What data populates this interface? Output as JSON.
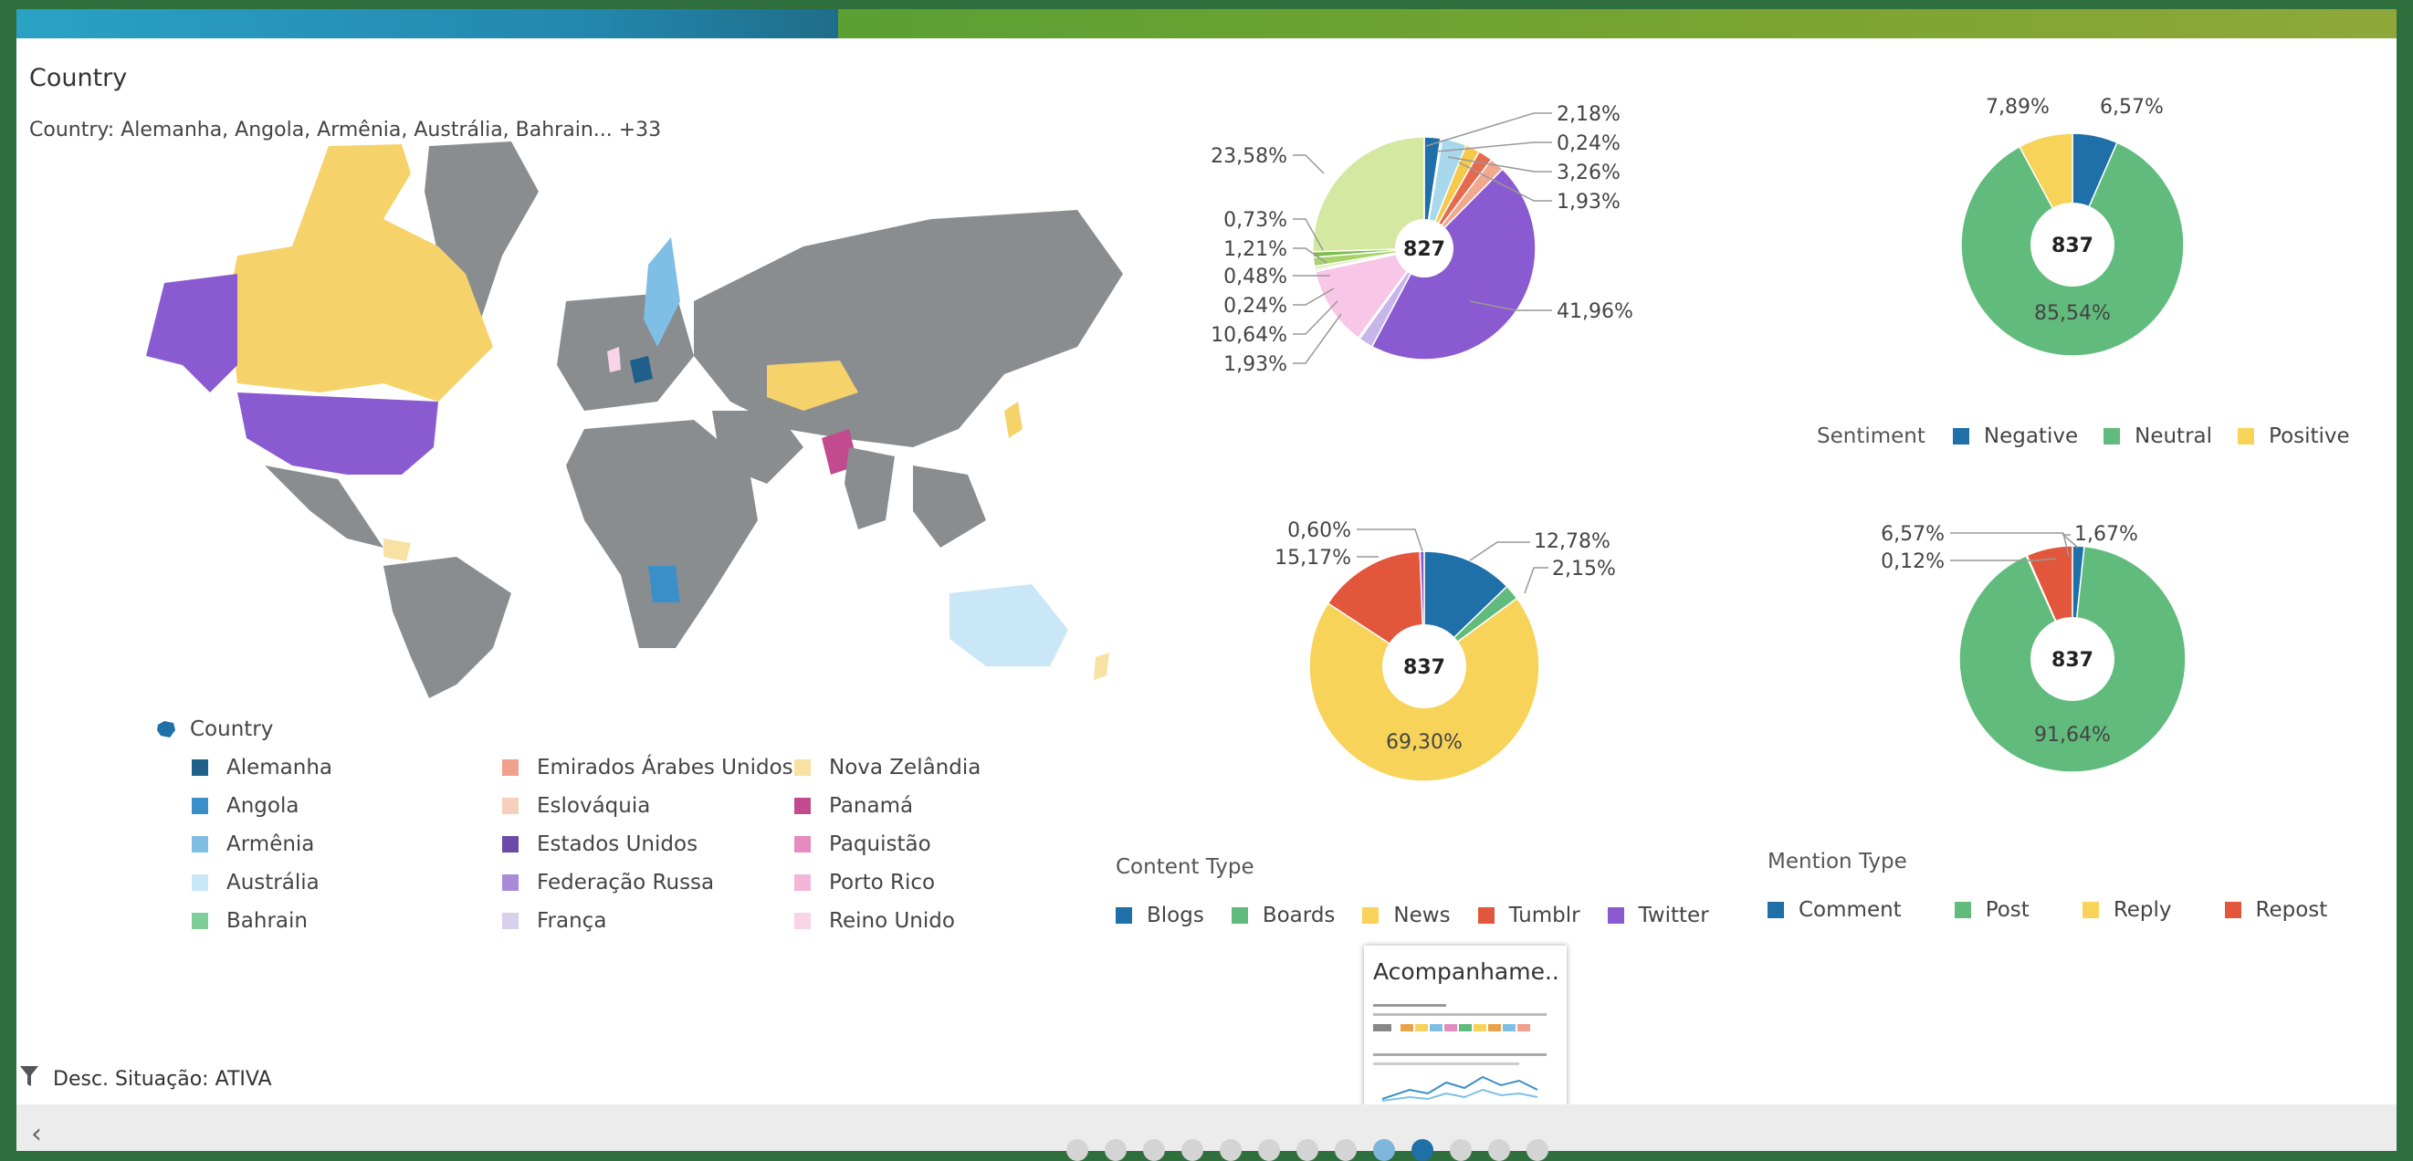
{
  "header": {
    "title": "Country",
    "filter_summary": "Country: Alemanha, Angola, Armênia, Austrália, Bahrain... +33"
  },
  "country_legend": {
    "title": "Country",
    "columns": [
      [
        {
          "label": "Alemanha",
          "color": "#1f5f8b"
        },
        {
          "label": "Angola",
          "color": "#3b8fc8"
        },
        {
          "label": "Armênia",
          "color": "#7fbfe6"
        },
        {
          "label": "Austrália",
          "color": "#c9e7f7"
        },
        {
          "label": "Bahrain",
          "color": "#7fce99"
        }
      ],
      [
        {
          "label": "Emirados Árabes Unidos",
          "color": "#f0a08e"
        },
        {
          "label": "Eslováquia",
          "color": "#f6cfbe"
        },
        {
          "label": "Estados Unidos",
          "color": "#6c4ba8"
        },
        {
          "label": "Federação Russa",
          "color": "#a98ad8"
        },
        {
          "label": "França",
          "color": "#d8d0ec"
        }
      ],
      [
        {
          "label": "Nova Zelândia",
          "color": "#f7e2a4"
        },
        {
          "label": "Panamá",
          "color": "#c24b8f"
        },
        {
          "label": "Paquistão",
          "color": "#e48bbf"
        },
        {
          "label": "Porto Rico",
          "color": "#f3b6d8"
        },
        {
          "label": "Reino Unido",
          "color": "#f9d4e6"
        }
      ]
    ]
  },
  "pie_platform": {
    "center": "827",
    "labels_right": [
      "2,18%",
      "0,24%",
      "3,26%",
      "1,93%",
      "41,96%"
    ],
    "labels_left": [
      "23,58%",
      "0,73%",
      "1,21%",
      "0,48%",
      "0,24%",
      "10,64%",
      "1,93%"
    ],
    "slices": [
      {
        "value": 2.18,
        "color": "#1f6fa8"
      },
      {
        "value": 0.24,
        "color": "#56b2d6"
      },
      {
        "value": 3.26,
        "color": "#a8d8ec"
      },
      {
        "value": 1.93,
        "color": "#f6c94b"
      },
      {
        "value": 1.93,
        "color": "#e66a4e"
      },
      {
        "value": 1.93,
        "color": "#f0a88f"
      },
      {
        "value": 41.96,
        "color": "#8a5bd0"
      },
      {
        "value": 1.93,
        "color": "#c7b6ea"
      },
      {
        "value": 0.24,
        "color": "#e0d5f2"
      },
      {
        "value": 10.64,
        "color": "#f8c6e6"
      },
      {
        "value": 0.24,
        "color": "#eaa2cd"
      },
      {
        "value": 0.48,
        "color": "#dcecc0"
      },
      {
        "value": 1.21,
        "color": "#a9d26b"
      },
      {
        "value": 0.73,
        "color": "#7ebd4a"
      },
      {
        "value": 23.58,
        "color": "#d4e8a2"
      }
    ]
  },
  "pie_sentiment": {
    "center": "837",
    "labels": {
      "negative": "6,57%",
      "positive": "7,89%",
      "neutral": "85,54%"
    },
    "slices": [
      {
        "value": 6.57,
        "color": "#1f6fa8"
      },
      {
        "value": 85.54,
        "color": "#61bb7c"
      },
      {
        "value": 7.89,
        "color": "#f7d35a"
      }
    ],
    "legend_title": "Sentiment",
    "legend": [
      {
        "label": "Negative",
        "color": "#1f6fa8"
      },
      {
        "label": "Neutral",
        "color": "#61bb7c"
      },
      {
        "label": "Positive",
        "color": "#f7d35a"
      }
    ]
  },
  "pie_content": {
    "center": "837",
    "labels": {
      "blogs": "12,78%",
      "boards": "2,15%",
      "news": "69,30%",
      "tumblr": "15,17%",
      "twitter": "0,60%"
    },
    "slices": [
      {
        "value": 12.78,
        "color": "#1f6fa8"
      },
      {
        "value": 2.15,
        "color": "#61bb7c"
      },
      {
        "value": 69.3,
        "color": "#f7d35a"
      },
      {
        "value": 15.17,
        "color": "#e2563c"
      },
      {
        "value": 0.6,
        "color": "#8a5bd0"
      }
    ],
    "legend_title": "Content Type",
    "legend": [
      {
        "label": "Blogs",
        "color": "#1f6fa8"
      },
      {
        "label": "Boards",
        "color": "#61bb7c"
      },
      {
        "label": "News",
        "color": "#f7d35a"
      },
      {
        "label": "Tumblr",
        "color": "#e2563c"
      },
      {
        "label": "Twitter",
        "color": "#8a5bd0"
      }
    ]
  },
  "pie_mention": {
    "center": "837",
    "labels": {
      "comment": "1,67%",
      "post": "91,64%",
      "repost": "6,57%",
      "reply": "0,12%"
    },
    "slices": [
      {
        "value": 1.67,
        "color": "#1f6fa8"
      },
      {
        "value": 91.64,
        "color": "#61bb7c"
      },
      {
        "value": 0.12,
        "color": "#f7d35a"
      },
      {
        "value": 6.57,
        "color": "#e2563c"
      }
    ],
    "legend_title": "Mention Type",
    "legend": [
      {
        "label": "Comment",
        "color": "#1f6fa8"
      },
      {
        "label": "Post",
        "color": "#61bb7c"
      },
      {
        "label": "Reply",
        "color": "#f7d35a"
      },
      {
        "label": "Repost",
        "color": "#e2563c"
      }
    ]
  },
  "thumbnail": {
    "title": "Acompanhame..."
  },
  "filter": {
    "label": "Desc. Situação:",
    "value": "ATIVA"
  },
  "pager": {
    "prev": "‹",
    "count": 13,
    "active": 10
  }
}
